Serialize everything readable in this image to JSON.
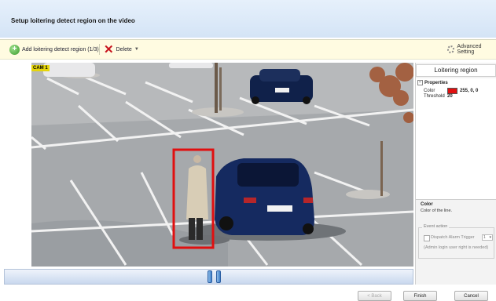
{
  "header": {
    "title": "Setup loitering detect region on the video"
  },
  "toolbar": {
    "add_label": "Add loitering detect region (1/3)",
    "delete_label": "Delete",
    "advanced_label": "Advanced Setting",
    "icons": {
      "add": "add-circle-icon",
      "delete": "red-x-icon",
      "advanced": "gear-icon"
    }
  },
  "video": {
    "cam_label": "CAM 1",
    "region_color": "#e01010"
  },
  "timeline": {
    "handles": [
      "left-handle",
      "right-handle"
    ]
  },
  "panel": {
    "title": "Loitering region",
    "properties_header": "Properties",
    "properties": [
      {
        "key": "Color",
        "value": "255, 0, 0",
        "swatch": "#e01010"
      },
      {
        "key": "Threshold",
        "value": "20"
      }
    ],
    "description_title": "Color",
    "description_text": "Color of the line.",
    "event_action": {
      "legend": "Event action",
      "checkbox_label": "Dispatch Alarm Trigger",
      "select_value": "1",
      "note": "(Admin login user right is needed)"
    }
  },
  "footer": {
    "back": "< Back",
    "finish": "Finish",
    "cancel": "Cancel"
  }
}
